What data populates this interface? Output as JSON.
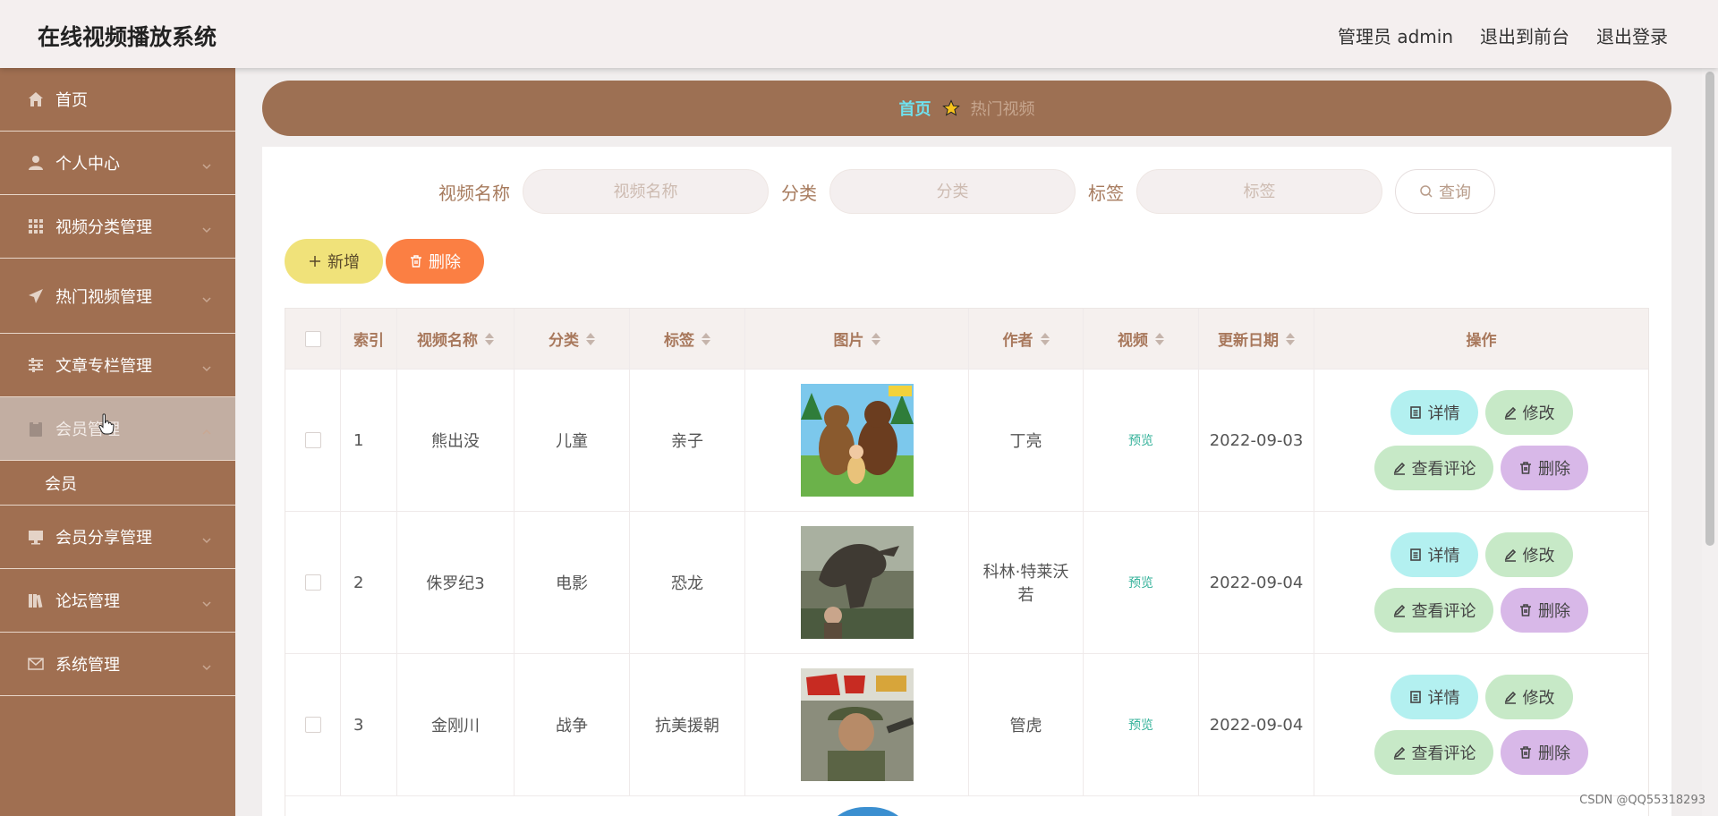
{
  "header": {
    "title": "在线视频播放系统",
    "user": "管理员 admin",
    "to_frontend": "退出到前台",
    "logout": "退出登录"
  },
  "sidebar": {
    "items": [
      {
        "label": "首页",
        "icon": "home-icon"
      },
      {
        "label": "个人中心",
        "icon": "user-icon"
      },
      {
        "label": "视频分类管理",
        "icon": "grid-icon"
      },
      {
        "label": "热门视频管理",
        "icon": "send-icon"
      },
      {
        "label": "文章专栏管理",
        "icon": "sliders-icon"
      },
      {
        "label": "会员管理",
        "icon": "clipboard-icon"
      },
      {
        "label": "会员分享管理",
        "icon": "monitor-icon"
      },
      {
        "label": "论坛管理",
        "icon": "books-icon"
      },
      {
        "label": "系统管理",
        "icon": "mail-icon"
      }
    ],
    "submenu": {
      "label": "会员"
    }
  },
  "breadcrumb": {
    "home": "首页",
    "current": "热门视频"
  },
  "search": {
    "name_label": "视频名称",
    "name_placeholder": "视频名称",
    "category_label": "分类",
    "category_placeholder": "分类",
    "tag_label": "标签",
    "tag_placeholder": "标签",
    "button": "查询"
  },
  "actions": {
    "add": "新增",
    "delete": "删除"
  },
  "table": {
    "columns": [
      "索引",
      "视频名称",
      "分类",
      "标签",
      "图片",
      "作者",
      "视频",
      "更新日期",
      "操作"
    ],
    "rows": [
      {
        "index": "1",
        "name": "熊出没",
        "category": "儿童",
        "tag": "亲子",
        "author": "丁亮",
        "video": "预览",
        "date": "2022-09-03",
        "image": "cartoon-bears-thumbnail"
      },
      {
        "index": "2",
        "name": "侏罗纪3",
        "category": "电影",
        "tag": "恐龙",
        "author": "科林·特莱沃若",
        "video": "预览",
        "date": "2022-09-04",
        "image": "dinosaur-movie-thumbnail"
      },
      {
        "index": "3",
        "name": "金刚川",
        "category": "战争",
        "tag": "抗美援朝",
        "author": "管虎",
        "video": "预览",
        "date": "2022-09-04",
        "image": "war-movie-poster-thumbnail"
      }
    ],
    "ops": {
      "detail": "详情",
      "edit": "修改",
      "comments": "查看评论",
      "delete": "删除"
    }
  },
  "colors": {
    "sidebar": "#a06f51",
    "breadcrumb_bar": "#9d7053",
    "add_button": "#f0e27a",
    "delete_button": "#fb7f43",
    "detail_button": "#b3f0f0",
    "edit_button": "#c7e9c7",
    "row_delete_button": "#d8b8e8"
  },
  "watermark": "CSDN @QQ55318293"
}
